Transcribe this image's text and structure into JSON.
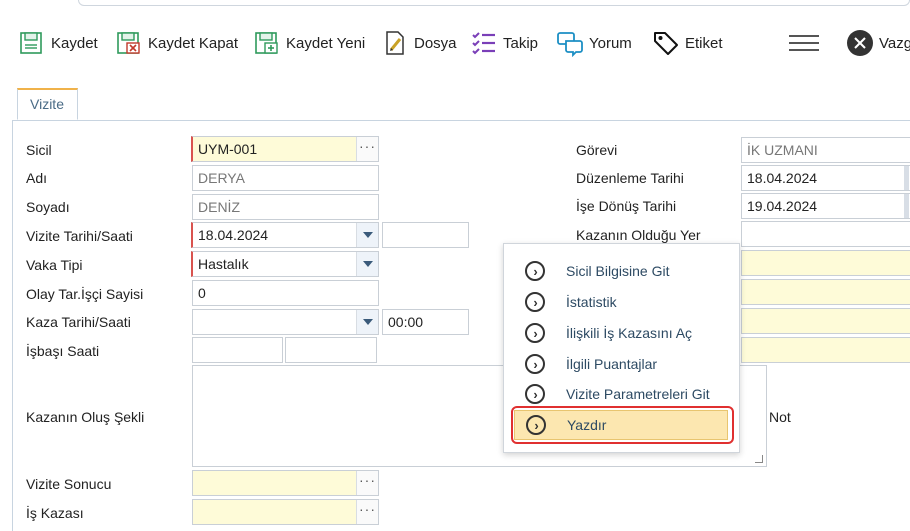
{
  "toolbar": {
    "save": "Kaydet",
    "save_close": "Kaydet Kapat",
    "save_new": "Kaydet Yeni",
    "file": "Dosya",
    "follow": "Takip",
    "comment": "Yorum",
    "tag": "Etiket",
    "cancel": "Vazg"
  },
  "tab": {
    "label": "Vizite"
  },
  "form": {
    "sicil_label": "Sicil",
    "sicil_value": "UYM-001",
    "adi_label": "Adı",
    "adi_value": "DERYA",
    "soyadi_label": "Soyadı",
    "soyadi_value": "DENİZ",
    "vizite_tarihi_label": "Vizite Tarihi/Saati",
    "vizite_tarihi_value": "18.04.2024",
    "vaka_tipi_label": "Vaka Tipi",
    "vaka_tipi_value": "Hastalık",
    "olay_label": "Olay Tar.İşçi Sayisi",
    "olay_value": "0",
    "kaza_tarihi_label": "Kaza Tarihi/Saati",
    "kaza_saati_value": "00:00",
    "isbasi_label": "İşbaşı Saati",
    "olus_label": "Kazanın Oluş Şekli",
    "sonuc_label": "Vizite Sonucu",
    "is_kazasi_label": "İş Kazası",
    "gorevi_label": "Görevi",
    "gorevi_value": "İK UZMANI",
    "duzenleme_label": "Düzenleme Tarihi",
    "duzenleme_value": "18.04.2024",
    "donus_label": "İşe Dönüş Tarihi",
    "donus_value": "19.04.2024",
    "yer_label": "Kazanın Olduğu Yer",
    "not_label": "Not"
  },
  "context_menu": {
    "items": [
      "Sicil Bilgisine Git",
      "İstatistik",
      "İlişkili İş Kazasını Aç",
      "İlgili Puantajlar",
      "Vizite Parametreleri Git",
      "Yazdır"
    ],
    "active_item": "Yazdır"
  },
  "colors": {
    "required": "#d9534f",
    "highlight": "#fce7b0",
    "annotation": "#e03030"
  }
}
